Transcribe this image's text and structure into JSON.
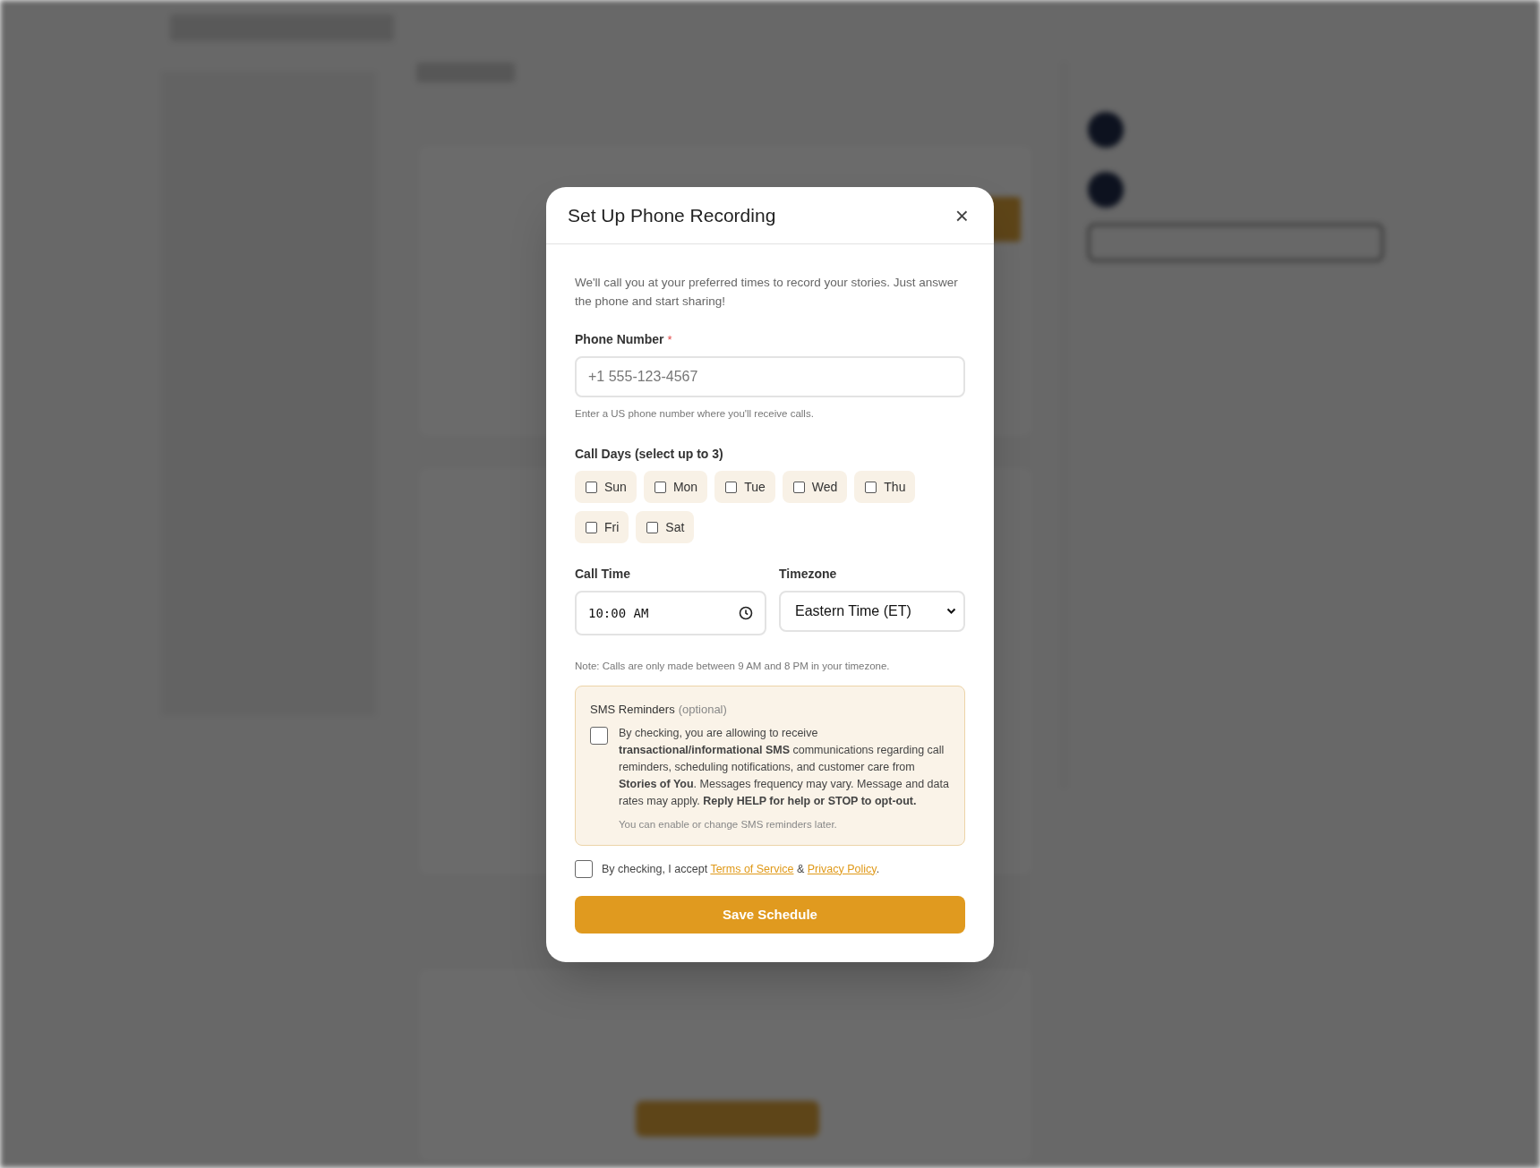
{
  "dialog": {
    "title": "Set Up Phone Recording",
    "close": "×",
    "intro": "We'll call you at your preferred times to record your stories. Just answer the phone and start sharing!",
    "phone": {
      "label": "Phone Number",
      "required_mark": "*",
      "placeholder": "+1 555-123-4567",
      "hint": "Enter a US phone number where you'll receive calls."
    },
    "call_days": {
      "label": "Call Days (select up to 3)",
      "days": [
        {
          "label": "Sun",
          "checked": false
        },
        {
          "label": "Mon",
          "checked": false
        },
        {
          "label": "Tue",
          "checked": false
        },
        {
          "label": "Wed",
          "checked": false
        },
        {
          "label": "Thu",
          "checked": false
        },
        {
          "label": "Fri",
          "checked": false
        },
        {
          "label": "Sat",
          "checked": false
        }
      ]
    },
    "call_time": {
      "label": "Call Time",
      "value": "10:00 AM"
    },
    "timezone": {
      "label": "Timezone",
      "value": "Eastern Time (ET)"
    },
    "note": "Note: Calls are only made between 9 AM and 8 PM in your timezone.",
    "sms": {
      "title": "SMS Reminders",
      "optional": "(optional)",
      "checked": false,
      "text": "By checking, you are allowing to receive **transactional/informational SMS** communications regarding call reminders, scheduling notifications, and customer care from **Stories of You**. Messages frequency may vary. Message and data rates may apply. **Reply HELP for help or STOP to opt-out.**",
      "footnote": "You can enable or change SMS reminders later."
    },
    "terms": {
      "checked": false,
      "prefix": "By checking, I accept",
      "link_1": "Terms of Service",
      "between": "&",
      "link_2": "Privacy Policy",
      "suffix": "."
    },
    "save_button": "Save Schedule"
  }
}
